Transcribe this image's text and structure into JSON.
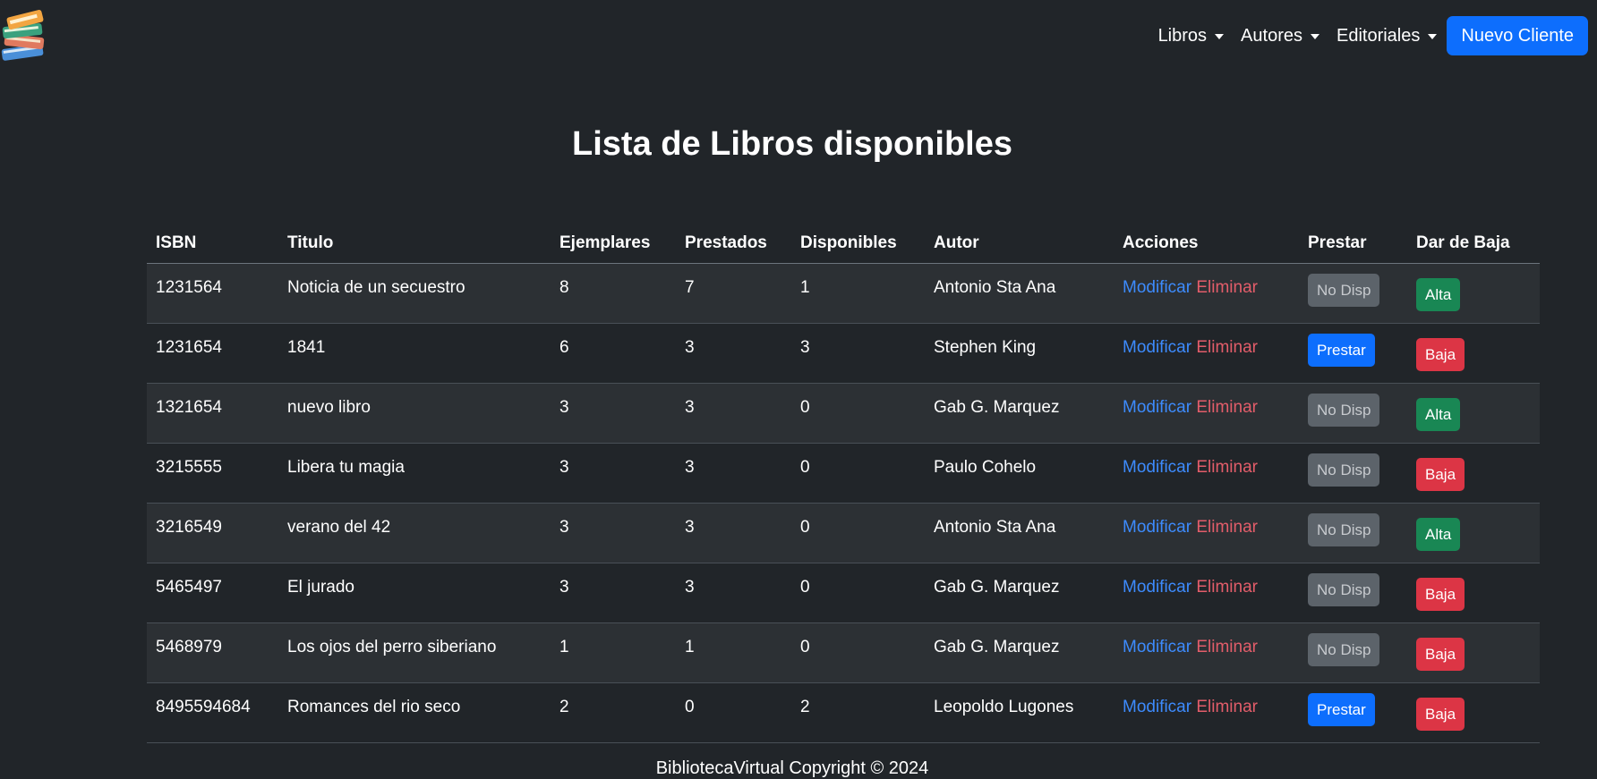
{
  "nav": {
    "items": [
      {
        "label": "Libros"
      },
      {
        "label": "Autores"
      },
      {
        "label": "Editoriales"
      }
    ],
    "new_client_label": "Nuevo Cliente"
  },
  "page": {
    "title": "Lista de Libros disponibles"
  },
  "table": {
    "headers": [
      "ISBN",
      "Titulo",
      "Ejemplares",
      "Prestados",
      "Disponibles",
      "Autor",
      "Acciones",
      "Prestar",
      "Dar de Baja"
    ],
    "rows": [
      {
        "isbn": "1231564",
        "titulo": "Noticia de un secuestro",
        "ejemplares": "8",
        "prestados": "7",
        "disponibles": "1",
        "autor": "Antonio Sta Ana",
        "modificar": "Modificar",
        "eliminar": "Eliminar",
        "prestar": "No Disp",
        "baja": "Alta"
      },
      {
        "isbn": "1231654",
        "titulo": "1841",
        "ejemplares": "6",
        "prestados": "3",
        "disponibles": "3",
        "autor": "Stephen King",
        "modificar": "Modificar",
        "eliminar": "Eliminar",
        "prestar": "Prestar",
        "baja": "Baja"
      },
      {
        "isbn": "1321654",
        "titulo": "nuevo libro",
        "ejemplares": "3",
        "prestados": "3",
        "disponibles": "0",
        "autor": "Gab G. Marquez",
        "modificar": "Modificar",
        "eliminar": "Eliminar",
        "prestar": "No Disp",
        "baja": "Alta"
      },
      {
        "isbn": "3215555",
        "titulo": "Libera tu magia",
        "ejemplares": "3",
        "prestados": "3",
        "disponibles": "0",
        "autor": "Paulo Cohelo",
        "modificar": "Modificar",
        "eliminar": "Eliminar",
        "prestar": "No Disp",
        "baja": "Baja"
      },
      {
        "isbn": "3216549",
        "titulo": "verano del 42",
        "ejemplares": "3",
        "prestados": "3",
        "disponibles": "0",
        "autor": "Antonio Sta Ana",
        "modificar": "Modificar",
        "eliminar": "Eliminar",
        "prestar": "No Disp",
        "baja": "Alta"
      },
      {
        "isbn": "5465497",
        "titulo": "El jurado",
        "ejemplares": "3",
        "prestados": "3",
        "disponibles": "0",
        "autor": "Gab G. Marquez",
        "modificar": "Modificar",
        "eliminar": "Eliminar",
        "prestar": "No Disp",
        "baja": "Baja"
      },
      {
        "isbn": "5468979",
        "titulo": "Los ojos del perro siberiano",
        "ejemplares": "1",
        "prestados": "1",
        "disponibles": "0",
        "autor": "Gab G. Marquez",
        "modificar": "Modificar",
        "eliminar": "Eliminar",
        "prestar": "No Disp",
        "baja": "Baja"
      },
      {
        "isbn": "8495594684",
        "titulo": "Romances del rio seco",
        "ejemplares": "2",
        "prestados": "0",
        "disponibles": "2",
        "autor": "Leopoldo Lugones",
        "modificar": "Modificar",
        "eliminar": "Eliminar",
        "prestar": "Prestar",
        "baja": "Baja"
      }
    ]
  },
  "footer": {
    "text": "BibliotecaVirtual Copyright © 2024"
  },
  "colors": {
    "background": "#212529",
    "primary": "#0d6efd",
    "success": "#198754",
    "danger": "#dc3545",
    "secondary": "#5c636a"
  },
  "icons": {
    "logo": "books-stack-icon"
  }
}
